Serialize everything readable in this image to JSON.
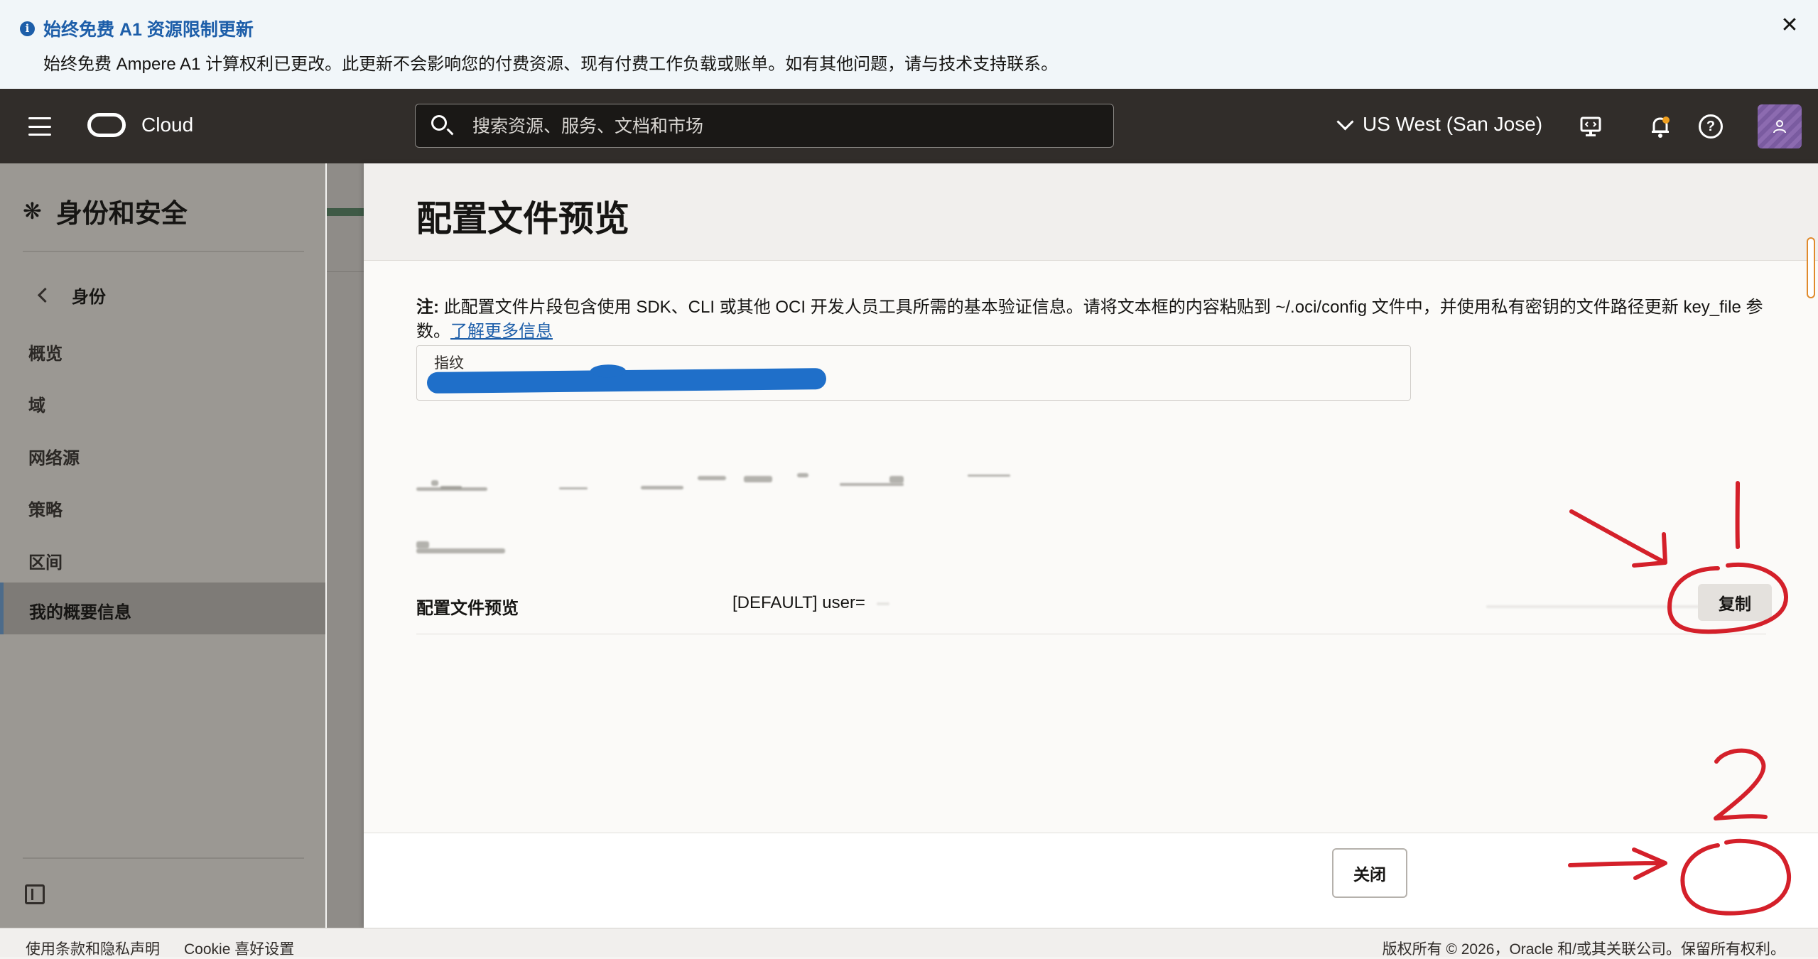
{
  "banner": {
    "title": "始终免费 A1 资源限制更新",
    "body": "始终免费 Ampere A1 计算权利已更改。此更新不会影响您的付费资源、现有付费工作负载或账单。如有其他问题，请与技术支持联系。",
    "info_icon": "i",
    "close_icon": "✕"
  },
  "topnav": {
    "logo_text": "Cloud",
    "search_placeholder": "搜索资源、服务、文档和市场",
    "region": "US West (San Jose)",
    "icons": [
      "menu-icon",
      "search-icon",
      "chevron-down-icon",
      "developer-tools-icon",
      "bell-icon",
      "help-icon",
      "avatar"
    ]
  },
  "sidebar": {
    "title": "身份和安全",
    "back_label": "身份",
    "items": [
      {
        "label": "概览"
      },
      {
        "label": "域"
      },
      {
        "label": "网络源"
      },
      {
        "label": "策略"
      },
      {
        "label": "区间"
      },
      {
        "label": "我的概要信息",
        "active": true
      }
    ]
  },
  "panel": {
    "title": "配置文件预览",
    "note_strong": "注:",
    "note_text": " 此配置文件片段包含使用 SDK、CLI 或其他 OCI 开发人员工具所需的基本验证信息。请将文本框的内容粘贴到 ~/.oci/config 文件中，并使用私有密钥的文件路径更新 key_file 参数。",
    "note_link": "了解更多信息",
    "fingerprint_label": "指纹",
    "row_label": "配置文件预览",
    "row_value": "[DEFAULT] user=",
    "copy_label": "复制",
    "close_label": "关闭"
  },
  "annotations": {
    "step1": "1",
    "step2": "2",
    "ink_color": "#d4202a"
  },
  "footer": {
    "terms": "使用条款和隐私声明",
    "cookie": "Cookie 喜好设置",
    "copyright": "版权所有 © 2026，Oracle 和/或其关联公司。保留所有权利。"
  },
  "colors": {
    "nav_bg": "#312d2a",
    "link": "#1d5ea9",
    "redaction": "#1f6fc9"
  }
}
